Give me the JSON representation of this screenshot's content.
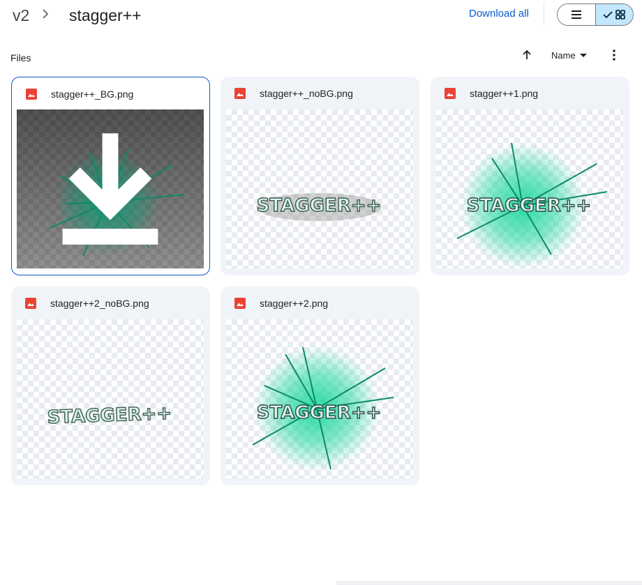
{
  "breadcrumb": {
    "root": "v2",
    "current": "stagger++"
  },
  "header": {
    "download_all": "Download all"
  },
  "view_toggle": {
    "list_icon": "list-icon",
    "grid_icon": "grid-icon",
    "selected": "grid"
  },
  "files_section": {
    "label": "Files",
    "sort_label": "Name"
  },
  "colors": {
    "accent": "#0b57d0",
    "card_bg": "#f0f4f9",
    "toggle_selected": "#c2e7ff",
    "file_icon": "#ea4335",
    "glow": "#1fd8a0"
  },
  "files": [
    {
      "name": "stagger++_BG.png",
      "icon": "image-icon",
      "selected": true,
      "preview": "shatter on dark background"
    },
    {
      "name": "stagger++_noBG.png",
      "icon": "image-icon",
      "selected": false,
      "preview_text": "STAGGER++"
    },
    {
      "name": "stagger++1.png",
      "icon": "image-icon",
      "selected": false,
      "preview_text": "STAGGER++"
    },
    {
      "name": "stagger++2_noBG.png",
      "icon": "image-icon",
      "selected": false,
      "preview_text": "STAGGER++"
    },
    {
      "name": "stagger++2.png",
      "icon": "image-icon",
      "selected": false,
      "preview_text": "STAGGER++"
    }
  ]
}
